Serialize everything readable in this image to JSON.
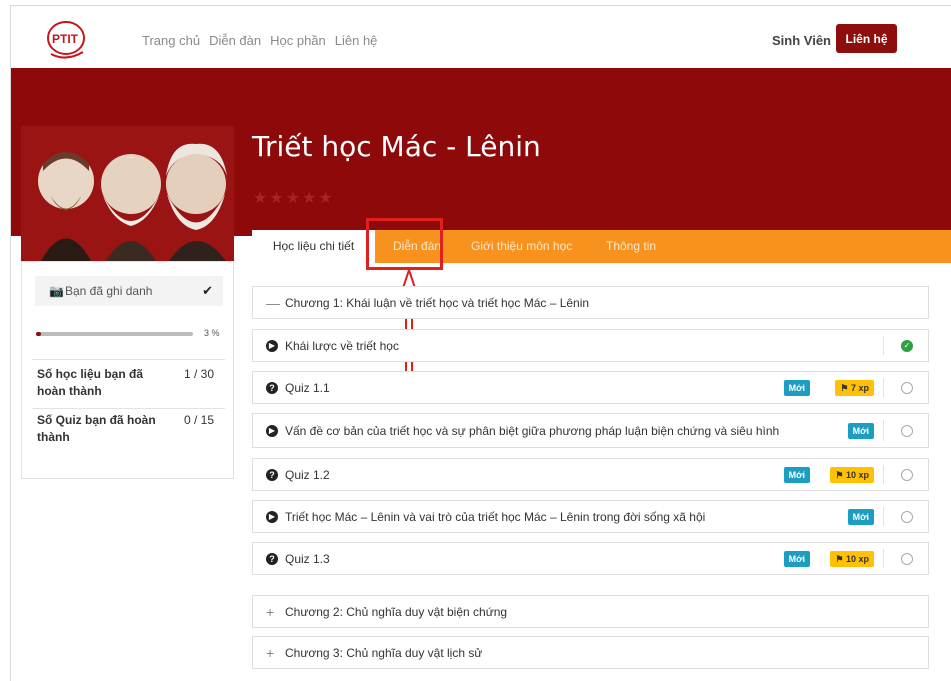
{
  "nav": {
    "links": [
      "Trang chủ",
      "Diễn đàn",
      "Học phần",
      "Liên hệ"
    ],
    "user_label": "Sinh Viên",
    "contact_button": "Liên hệ",
    "logo_text": "PTIT"
  },
  "course": {
    "title": "Triết học Mác - Lênin",
    "stars": "★★★★★"
  },
  "tabs": [
    "Học liệu chi tiết",
    "Diễn đàn",
    "Giới thiệu môn học",
    "Thông tin"
  ],
  "sidebar": {
    "enrolled_label": "Bạn đã ghi danh",
    "progress_percent": 3,
    "progress_label": "3 %",
    "stats": [
      {
        "label": "Số học liệu bạn đã hoàn thành",
        "value": "1 / 30"
      },
      {
        "label": "Số Quiz bạn đã hoàn thành",
        "value": "0 / 15"
      }
    ]
  },
  "chapters": [
    {
      "title": "Chương 1: Khái luận về triết học và triết học Mác – Lênin",
      "expanded": true
    },
    {
      "title": "Chương 2: Chủ nghĩa duy vật biện chứng",
      "expanded": false
    },
    {
      "title": "Chương 3: Chủ nghĩa duy vật lịch sử",
      "expanded": false
    }
  ],
  "items": [
    {
      "type": "video",
      "title": "Khái lược về triết học",
      "new": "",
      "xp": "",
      "done": true
    },
    {
      "type": "quiz",
      "title": "Quiz 1.1",
      "new": "Mới",
      "xp": "7 xp",
      "done": false
    },
    {
      "type": "video",
      "title": "Vấn đề cơ bản của triết học và sự phân biệt giữa phương pháp luận biện chứng và siêu hình",
      "new": "Mới",
      "xp": "",
      "done": false
    },
    {
      "type": "quiz",
      "title": "Quiz 1.2",
      "new": "Mới",
      "xp": "10 xp",
      "done": false
    },
    {
      "type": "video",
      "title": "Triết học Mác – Lênin và vai trò của triết học Mác – Lênin trong đời sống xã hội",
      "new": "Mới",
      "xp": "",
      "done": false
    },
    {
      "type": "quiz",
      "title": "Quiz 1.3",
      "new": "Mới",
      "xp": "10 xp",
      "done": false
    }
  ],
  "colors": {
    "brand": "#8e0a0a",
    "tab_bar": "#f7921e",
    "badge_new": "#1b9ec1",
    "badge_xp": "#ffc107",
    "done": "#2ea043",
    "annotation": "#e01f1f"
  }
}
